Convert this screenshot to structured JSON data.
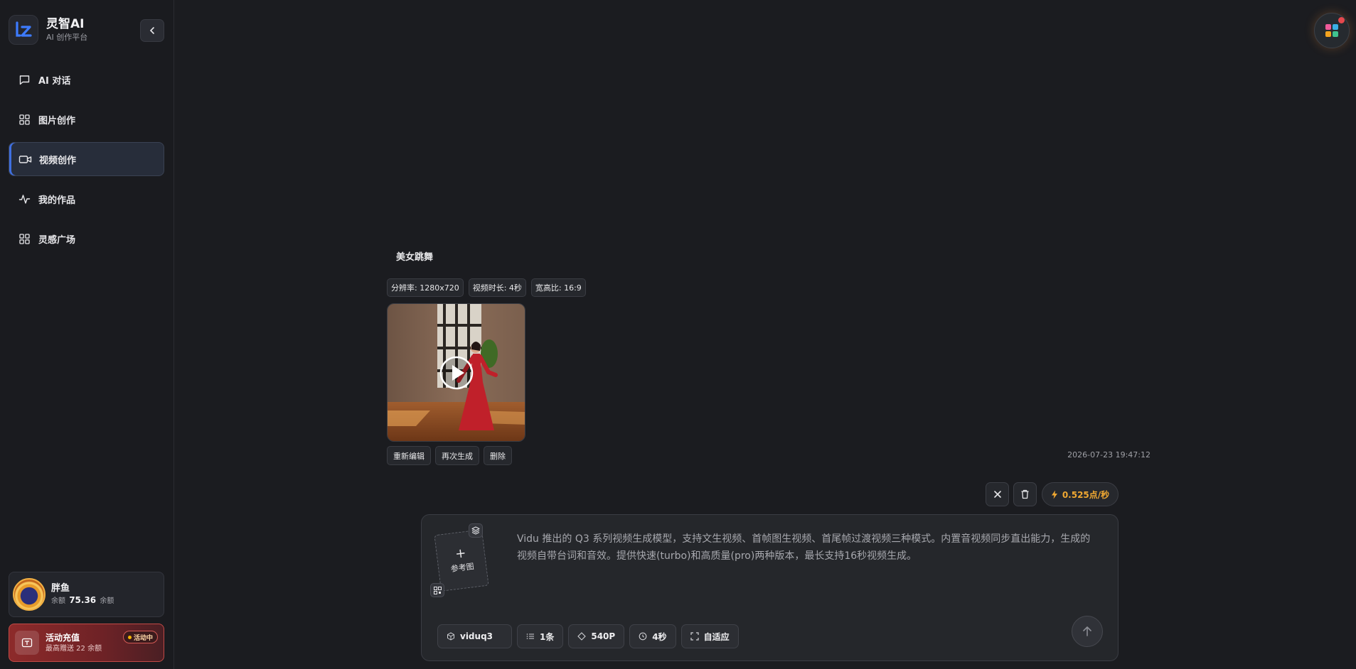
{
  "brand": {
    "name": "灵智AI",
    "subtitle": "AI 创作平台"
  },
  "nav": [
    {
      "label": "AI 对话",
      "icon": "chat-bubble-icon",
      "active": false
    },
    {
      "label": "图片创作",
      "icon": "grid-icon",
      "active": false
    },
    {
      "label": "视频创作",
      "icon": "video-camera-icon",
      "active": true
    },
    {
      "label": "我的作品",
      "icon": "activity-icon",
      "active": false
    },
    {
      "label": "灵感广场",
      "icon": "grid-icon",
      "active": false
    }
  ],
  "user": {
    "name": "胖鱼",
    "balance_prefix": "余额",
    "balance_value": "75.36",
    "balance_suffix": "余额"
  },
  "promo": {
    "title": "活动充值",
    "subtitle": "最高赠送 22 余额",
    "badge": "活动中"
  },
  "result": {
    "prompt": "美女跳舞",
    "tags": [
      "分辨率: 1280x720",
      "视频时长: 4秒",
      "宽高比: 16:9"
    ],
    "actions": [
      "重新编辑",
      "再次生成",
      "删除"
    ],
    "timestamp": "2026-07-23 19:47:12"
  },
  "toolbar": {
    "cost": "0.525点/秒"
  },
  "composer": {
    "ref_label": "参考图",
    "description": "Vidu 推出的 Q3 系列视频生成模型，支持文生视频、首帧图生视频、首尾帧过渡视频三种模式。内置音视频同步直出能力，生成的视频自带台词和音效。提供快速(turbo)和高质量(pro)两种版本，最长支持16秒视频生成。",
    "chips": [
      {
        "label": "viduq3",
        "icon": "cube-icon"
      },
      {
        "label": "1条",
        "icon": "list-icon"
      },
      {
        "label": "540P",
        "icon": "diamond-icon"
      },
      {
        "label": "4秒",
        "icon": "clock-icon"
      },
      {
        "label": "自适应",
        "icon": "expand-icon"
      }
    ]
  },
  "colors": {
    "accent": "#3f6fe0",
    "cost": "#f0a832",
    "promo": "#8d2a2a",
    "background": "#1b1c20"
  }
}
